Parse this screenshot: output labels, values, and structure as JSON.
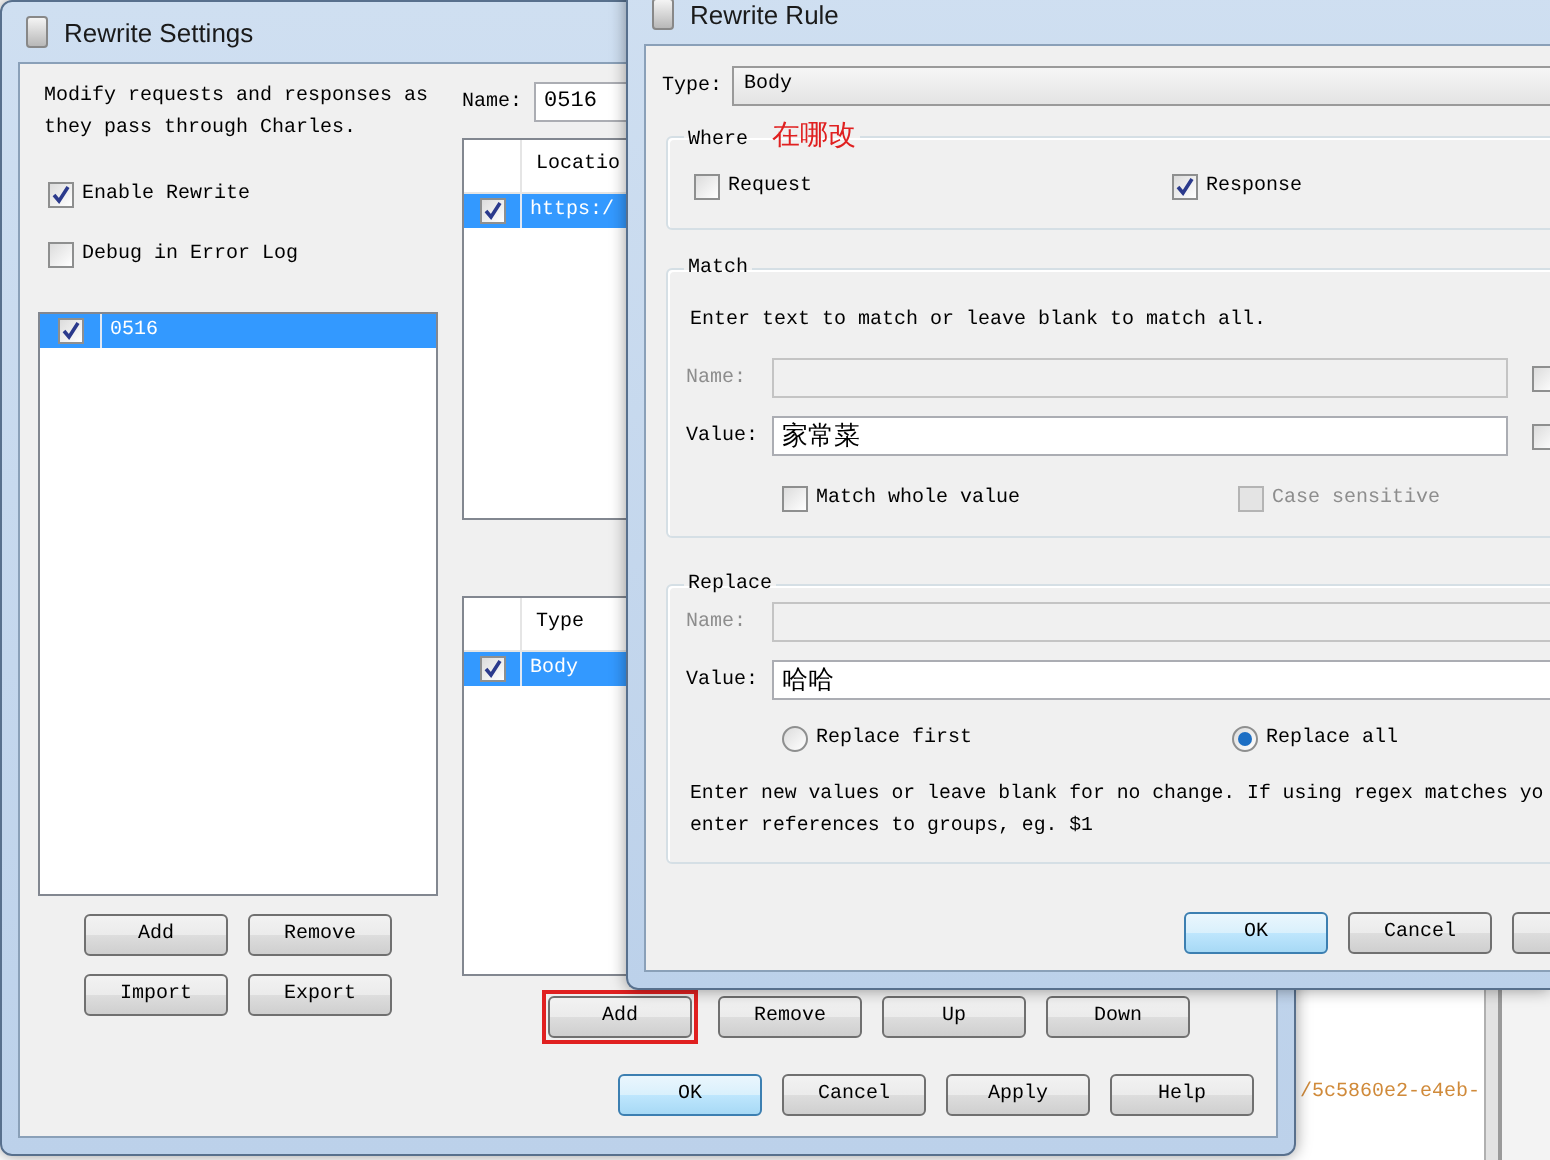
{
  "settings_window": {
    "title": "Rewrite Settings",
    "description": "Modify requests and responses as they pass through Charles.",
    "options": [
      {
        "label": "Enable Rewrite",
        "checked": true
      },
      {
        "label": "Debug in Error Log",
        "checked": false
      }
    ],
    "sets": [
      {
        "name": "0516",
        "checked": true,
        "selected": true
      }
    ],
    "set_buttons": [
      "Add",
      "Remove",
      "Import",
      "Export"
    ],
    "name_label": "Name:",
    "name_value": "0516",
    "locations": {
      "columns": [
        "Locatio"
      ],
      "rows": [
        {
          "location": "https:/",
          "checked": true,
          "selected": true
        }
      ]
    },
    "rules": {
      "columns": [
        "Type"
      ],
      "rows": [
        {
          "type": "Body",
          "checked": true,
          "selected": true
        }
      ]
    },
    "rule_buttons": [
      {
        "label": "Add",
        "highlighted": true
      },
      {
        "label": "Remove",
        "highlighted": false
      },
      {
        "label": "Up",
        "highlighted": false
      },
      {
        "label": "Down",
        "highlighted": false
      }
    ],
    "dialog_buttons": [
      {
        "label": "OK",
        "default": true
      },
      {
        "label": "Cancel",
        "default": false
      },
      {
        "label": "Apply",
        "default": false
      },
      {
        "label": "Help",
        "default": false
      }
    ]
  },
  "rule_window": {
    "title": "Rewrite Rule",
    "type_label": "Type:",
    "type_value": "Body",
    "where": {
      "legend": "Where",
      "annotation": "在哪改",
      "options": [
        {
          "label": "Request",
          "checked": false
        },
        {
          "label": "Response",
          "checked": true
        }
      ]
    },
    "match": {
      "legend": "Match",
      "hint": "Enter text to match or leave blank to match all.",
      "fields": [
        {
          "label": "Name:",
          "disabled": true,
          "side_checked": false
        },
        {
          "label": "Value:",
          "value": "家常菜",
          "disabled": false,
          "side_checked": false
        }
      ],
      "options": [
        {
          "label": "Match whole value",
          "checked": false,
          "disabled": false
        },
        {
          "label": "Case sensitive",
          "checked": false,
          "disabled": true
        }
      ]
    },
    "replace": {
      "legend": "Replace",
      "fields": [
        {
          "label": "Name:",
          "disabled": true
        },
        {
          "label": "Value:",
          "value": "哈哈",
          "disabled": false
        }
      ],
      "modes": [
        {
          "label": "Replace first",
          "selected": false
        },
        {
          "label": "Replace all",
          "selected": true
        }
      ],
      "hint_lines": [
        "Enter new values or leave blank for no change. If using regex matches yo",
        "enter references to groups, eg. $1"
      ]
    },
    "buttons": [
      {
        "label": "OK",
        "default": true
      },
      {
        "label": "Cancel",
        "default": false
      }
    ]
  },
  "background": {
    "text": "/5c5860e2-e4eb-"
  }
}
